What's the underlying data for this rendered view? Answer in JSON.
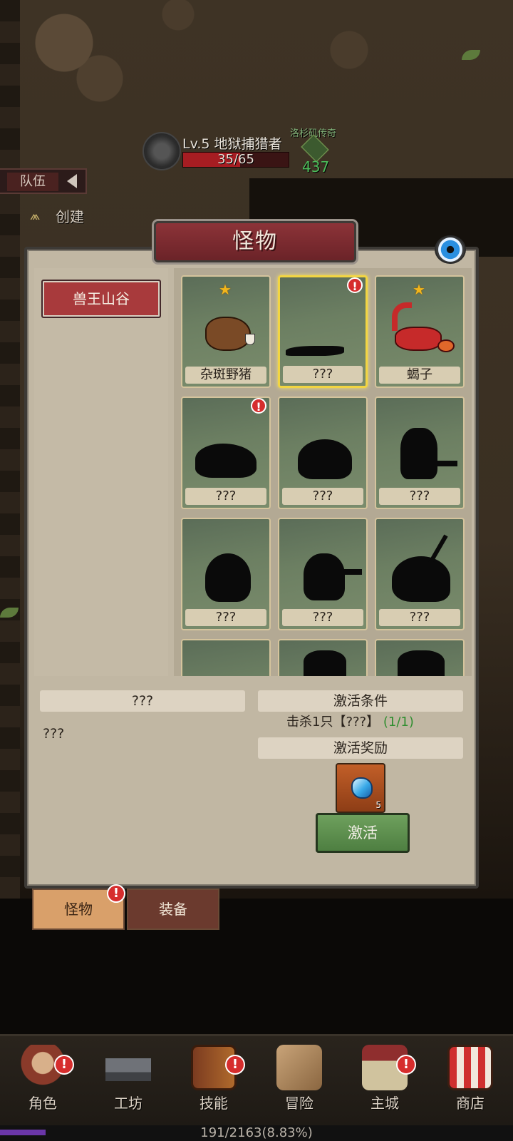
{
  "enemy": {
    "name": "Lv.5 地狱捕猎者",
    "hp_text": "35/65",
    "hp_fraction": 0.538
  },
  "ally": {
    "name": "洛杉矶传奇",
    "power": "437"
  },
  "team_tab": {
    "label": "队伍"
  },
  "create_button": {
    "label": "创建"
  },
  "panel": {
    "title": "怪物",
    "regions": [
      "兽王山谷"
    ],
    "monsters": [
      {
        "name": "杂斑野猪",
        "star": true,
        "alert": false,
        "selected": false
      },
      {
        "name": "???",
        "star": false,
        "alert": true,
        "selected": true
      },
      {
        "name": "蝎子",
        "star": true,
        "alert": false,
        "selected": false
      },
      {
        "name": "???",
        "star": false,
        "alert": true,
        "selected": false
      },
      {
        "name": "???",
        "star": false,
        "alert": false,
        "selected": false
      },
      {
        "name": "???",
        "star": false,
        "alert": false,
        "selected": false
      },
      {
        "name": "???",
        "star": false,
        "alert": false,
        "selected": false
      },
      {
        "name": "???",
        "star": false,
        "alert": false,
        "selected": false
      },
      {
        "name": "???",
        "star": false,
        "alert": false,
        "selected": false
      }
    ],
    "star_glyph": "★",
    "alert_glyph": "!"
  },
  "info": {
    "selected_name": "???",
    "description": "???",
    "condition_title": "激活条件",
    "condition_text": "击杀1只【???】",
    "condition_progress": "(1/1)",
    "reward_title": "激活奖励",
    "reward_count": "5",
    "reward_icon": "blue-gem-icon",
    "activate_label": "激活"
  },
  "bottom_tabs": {
    "monster": "怪物",
    "equip": "装备",
    "alert": "!"
  },
  "nav": {
    "items": [
      {
        "label": "角色",
        "alert": true,
        "icon": "character-icon"
      },
      {
        "label": "工坊",
        "alert": false,
        "icon": "anvil-icon"
      },
      {
        "label": "技能",
        "alert": true,
        "icon": "skill-book-icon"
      },
      {
        "label": "冒险",
        "alert": false,
        "icon": "adventure-map-icon"
      },
      {
        "label": "主城",
        "alert": true,
        "icon": "castle-icon"
      },
      {
        "label": "商店",
        "alert": false,
        "icon": "shop-icon"
      }
    ],
    "alert_glyph": "!"
  },
  "xp": {
    "text": "191/2163(8.83%)",
    "fraction": 0.0883
  }
}
